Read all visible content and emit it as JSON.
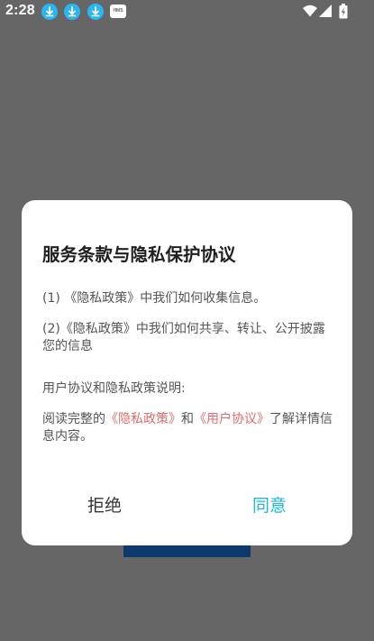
{
  "status_bar": {
    "time": "2:28",
    "notification_icons": [
      "download-icon",
      "download-icon",
      "download-icon",
      "hms-icon"
    ],
    "hms_label": "HMS",
    "system_icons": [
      "wifi-icon",
      "signal-icon",
      "battery-icon"
    ]
  },
  "dialog": {
    "title": "服务条款与隐私保护协议",
    "item1": "(1) 《隐私政策》中我们如何收集信息。",
    "item2": "(2)《隐私政策》中我们如何共享、转让、公开披露您的信息",
    "section_heading": "用户协议和隐私政策说明:",
    "read_prefix": "阅读完整的",
    "privacy_link": "《隐私政策》",
    "and_text": "和",
    "user_agreement_link": "《用户协议》",
    "read_suffix": "了解详情信息内容。",
    "reject_label": "拒绝",
    "agree_label": "同意"
  },
  "colors": {
    "overlay": "#666666",
    "dialog_bg": "#ffffff",
    "link": "#e06c6c",
    "agree": "#1fb7e0",
    "reject": "#333333",
    "download_badge": "#29b6f6"
  }
}
